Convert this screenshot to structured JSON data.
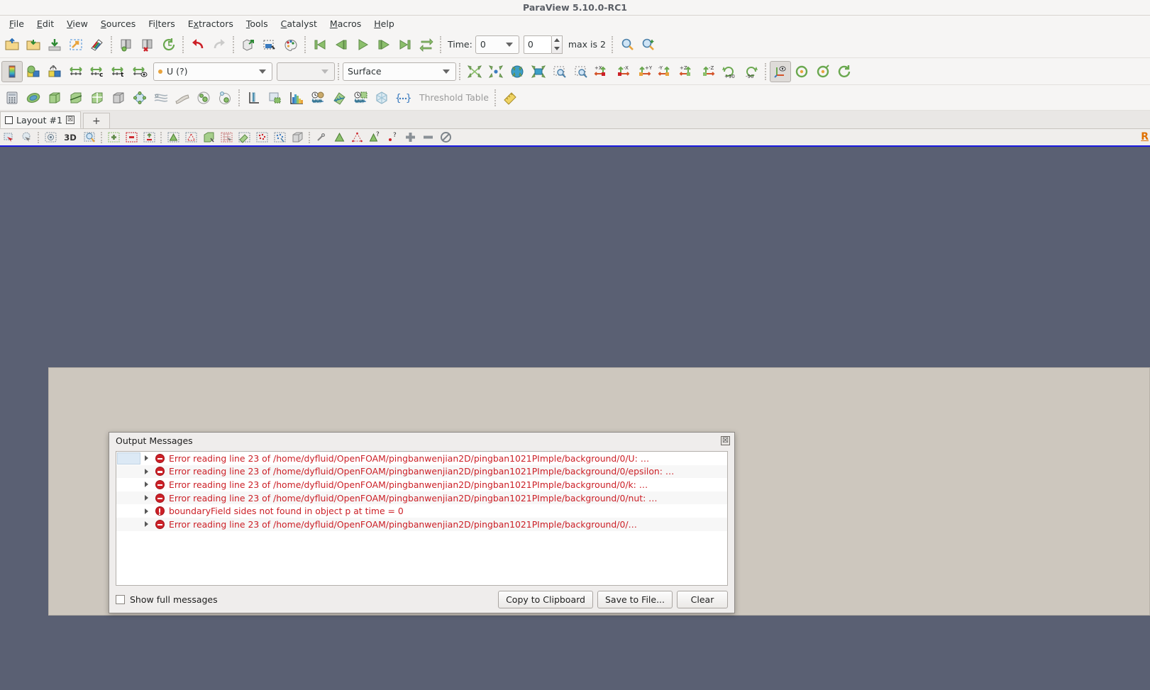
{
  "window": {
    "title": "ParaView 5.10.0-RC1"
  },
  "menubar": {
    "items": [
      {
        "label": "File",
        "accel": "F"
      },
      {
        "label": "Edit",
        "accel": "E"
      },
      {
        "label": "View",
        "accel": "V"
      },
      {
        "label": "Sources",
        "accel": "S"
      },
      {
        "label": "Filters",
        "accel": "l"
      },
      {
        "label": "Extractors",
        "accel": "x"
      },
      {
        "label": "Tools",
        "accel": "T"
      },
      {
        "label": "Catalyst",
        "accel": "C"
      },
      {
        "label": "Macros",
        "accel": "M"
      },
      {
        "label": "Help",
        "accel": "H"
      }
    ]
  },
  "toolbar_main": {
    "buttons": [
      "open-file-icon",
      "open-recent-icon",
      "save-data-icon",
      "save-state-icon",
      "save-screenshot-icon",
      "connect-server-icon",
      "disconnect-server-icon",
      "reset-session-icon",
      "undo-icon",
      "redo-icon",
      "camera-undo-icon",
      "camera-redo-icon",
      "edit-color-map-icon"
    ],
    "vcr": [
      "first-frame-icon",
      "previous-frame-icon",
      "play-icon",
      "next-frame-icon",
      "last-frame-icon",
      "loop-icon"
    ],
    "time_label": "Time:",
    "time_value": "0",
    "frame_value": "0",
    "max_label": "max is 2",
    "zoom_buttons": [
      "zoom-to-data-icon",
      "zoom-closest-to-data-icon"
    ]
  },
  "toolbar_repr": {
    "color_buttons": [
      "toggle-color-legend-icon",
      "edit-color-map-icon",
      "rescale-custom-icon",
      "rescale-to-data-range-icon",
      "rescale-to-custom-range-icon",
      "rescale-over-time-icon",
      "rescale-visible-icon"
    ],
    "array_value": "U (?)",
    "component_value": "",
    "representation_value": "Surface",
    "view_buttons": [
      "reset-camera-icon",
      "zoom-to-box-icon",
      "reset-camera-closest-icon",
      "zoom-closest-to-data-icon",
      "rubber-band-zoom-icon"
    ],
    "axis_buttons": [
      "plus-x-icon",
      "minus-x-icon",
      "plus-y-icon",
      "minus-y-icon",
      "plus-z-icon",
      "minus-z-icon",
      "rotate-90-cw-icon",
      "rotate-90-ccw-icon"
    ],
    "axis_labels": [
      "+X",
      "-X",
      "+Y",
      "-Y",
      "+Z",
      "-Z",
      "+90",
      "-90"
    ],
    "center_buttons": [
      "show-center-axes-icon",
      "reset-center-icon",
      "pick-center-icon",
      "rotate-center-icon"
    ]
  },
  "toolbar_filters": {
    "buttons": [
      "calculator-icon",
      "contour-icon",
      "clip-icon",
      "slice-icon",
      "threshold-icon",
      "extract-subset-icon",
      "glyph-icon",
      "stream-tracer-icon",
      "warp-icon",
      "group-datasets-icon",
      "extract-level-icon",
      "plot-over-line-icon",
      "extract-selection-icon",
      "histogram-icon",
      "plot-data-over-time-icon",
      "plot-on-intersection-curves-icon",
      "plot-selection-over-time-icon",
      "python-calculator-icon",
      "programmable-filter-icon"
    ],
    "threshold_label": "Threshold Table",
    "ruler_icon": "ruler-icon"
  },
  "layout": {
    "tab_label": "Layout #1",
    "tab_close": "☒",
    "add_tab": "+"
  },
  "view_toolbar": {
    "buttons": [
      "select-cells-on-icon",
      "select-points-on-icon",
      "select-cells-through-icon",
      "3d-label",
      "zoom-to-box-icon",
      "add-selection-icon",
      "subtract-selection-icon",
      "toggle-selection-icon",
      "select-cells-with-polygon-icon",
      "select-points-with-polygon-icon",
      "frustum-select-icon",
      "select-block-icon",
      "interactive-select-cells-icon",
      "interactive-select-points-icon",
      "hover-cells-icon",
      "hover-points-icon",
      "select-custom-box-icon",
      "grow-selection-icon",
      "shrink-selection-icon",
      "query-cells-icon",
      "query-points-icon",
      "plus-icon",
      "minus-icon",
      "clear-selection-icon"
    ],
    "mode_3d_label": "3D",
    "right_marker": "R"
  },
  "dialog": {
    "title": "Output Messages",
    "close_glyph": "☒",
    "messages": [
      {
        "severity": "error",
        "text": "Error reading line 23 of /home/dyfluid/OpenFOAM/pingbanwenjian2D/pingban1021PImple/background/0/U: …",
        "selected_cell": true
      },
      {
        "severity": "error",
        "text": "Error reading line 23 of /home/dyfluid/OpenFOAM/pingbanwenjian2D/pingban1021PImple/background/0/epsilon: …",
        "selected_cell": false
      },
      {
        "severity": "error",
        "text": "Error reading line 23 of /home/dyfluid/OpenFOAM/pingbanwenjian2D/pingban1021PImple/background/0/k: …",
        "selected_cell": false
      },
      {
        "severity": "error",
        "text": "Error reading line 23 of /home/dyfluid/OpenFOAM/pingbanwenjian2D/pingban1021PImple/background/0/nut: …",
        "selected_cell": false
      },
      {
        "severity": "warning",
        "text": "boundaryField sides not found in object p at time = 0",
        "selected_cell": false
      },
      {
        "severity": "error",
        "text": "Error reading line 23 of /home/dyfluid/OpenFOAM/pingbanwenjian2D/pingban1021PImple/background/0/…",
        "selected_cell": false
      }
    ],
    "show_full_label": "Show full messages",
    "show_full_checked": false,
    "buttons": {
      "copy": "Copy to Clipboard",
      "save": "Save to File...",
      "clear": "Clear"
    }
  },
  "colors": {
    "render_background": "#5a6073",
    "panel_background": "#cdc7be",
    "error_text": "#cc2027",
    "chrome": "#f6f5f4",
    "active_view_border": "#1a1ae0"
  }
}
